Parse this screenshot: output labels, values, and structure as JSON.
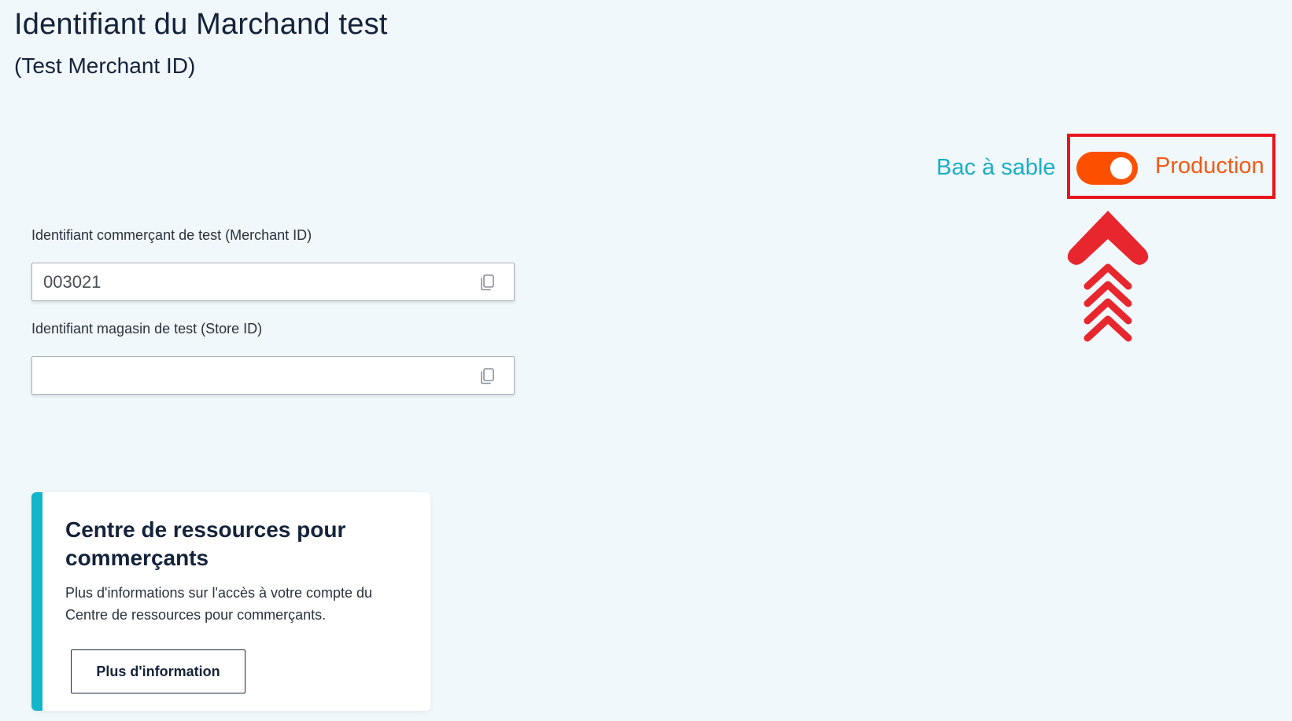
{
  "header": {
    "title": "Identifiant du Marchand test",
    "subtitle": "(Test Merchant ID)"
  },
  "environment": {
    "sandbox_label": "Bac à sable",
    "production_label": "Production",
    "toggle_state": "production",
    "toggle_color": "#fc5000",
    "highlight_color": "#e8161c"
  },
  "fields": {
    "merchant_id": {
      "label": "Identifiant commerçant de test (Merchant ID)",
      "value": "003021",
      "icon": "copy-icon"
    },
    "store_id": {
      "label": "Identifiant magasin de test (Store ID)",
      "value": "",
      "icon": "copy-icon"
    }
  },
  "resource_card": {
    "title": "Centre de ressources pour commerçants",
    "text": "Plus d'informations sur l'accès à votre compte du Centre de ressources pour commerçants.",
    "button_label": "Plus d'information",
    "accent_color": "#12b5c9"
  },
  "annotation": {
    "icon": "up-arrow-icon",
    "color": "#e8262e"
  }
}
